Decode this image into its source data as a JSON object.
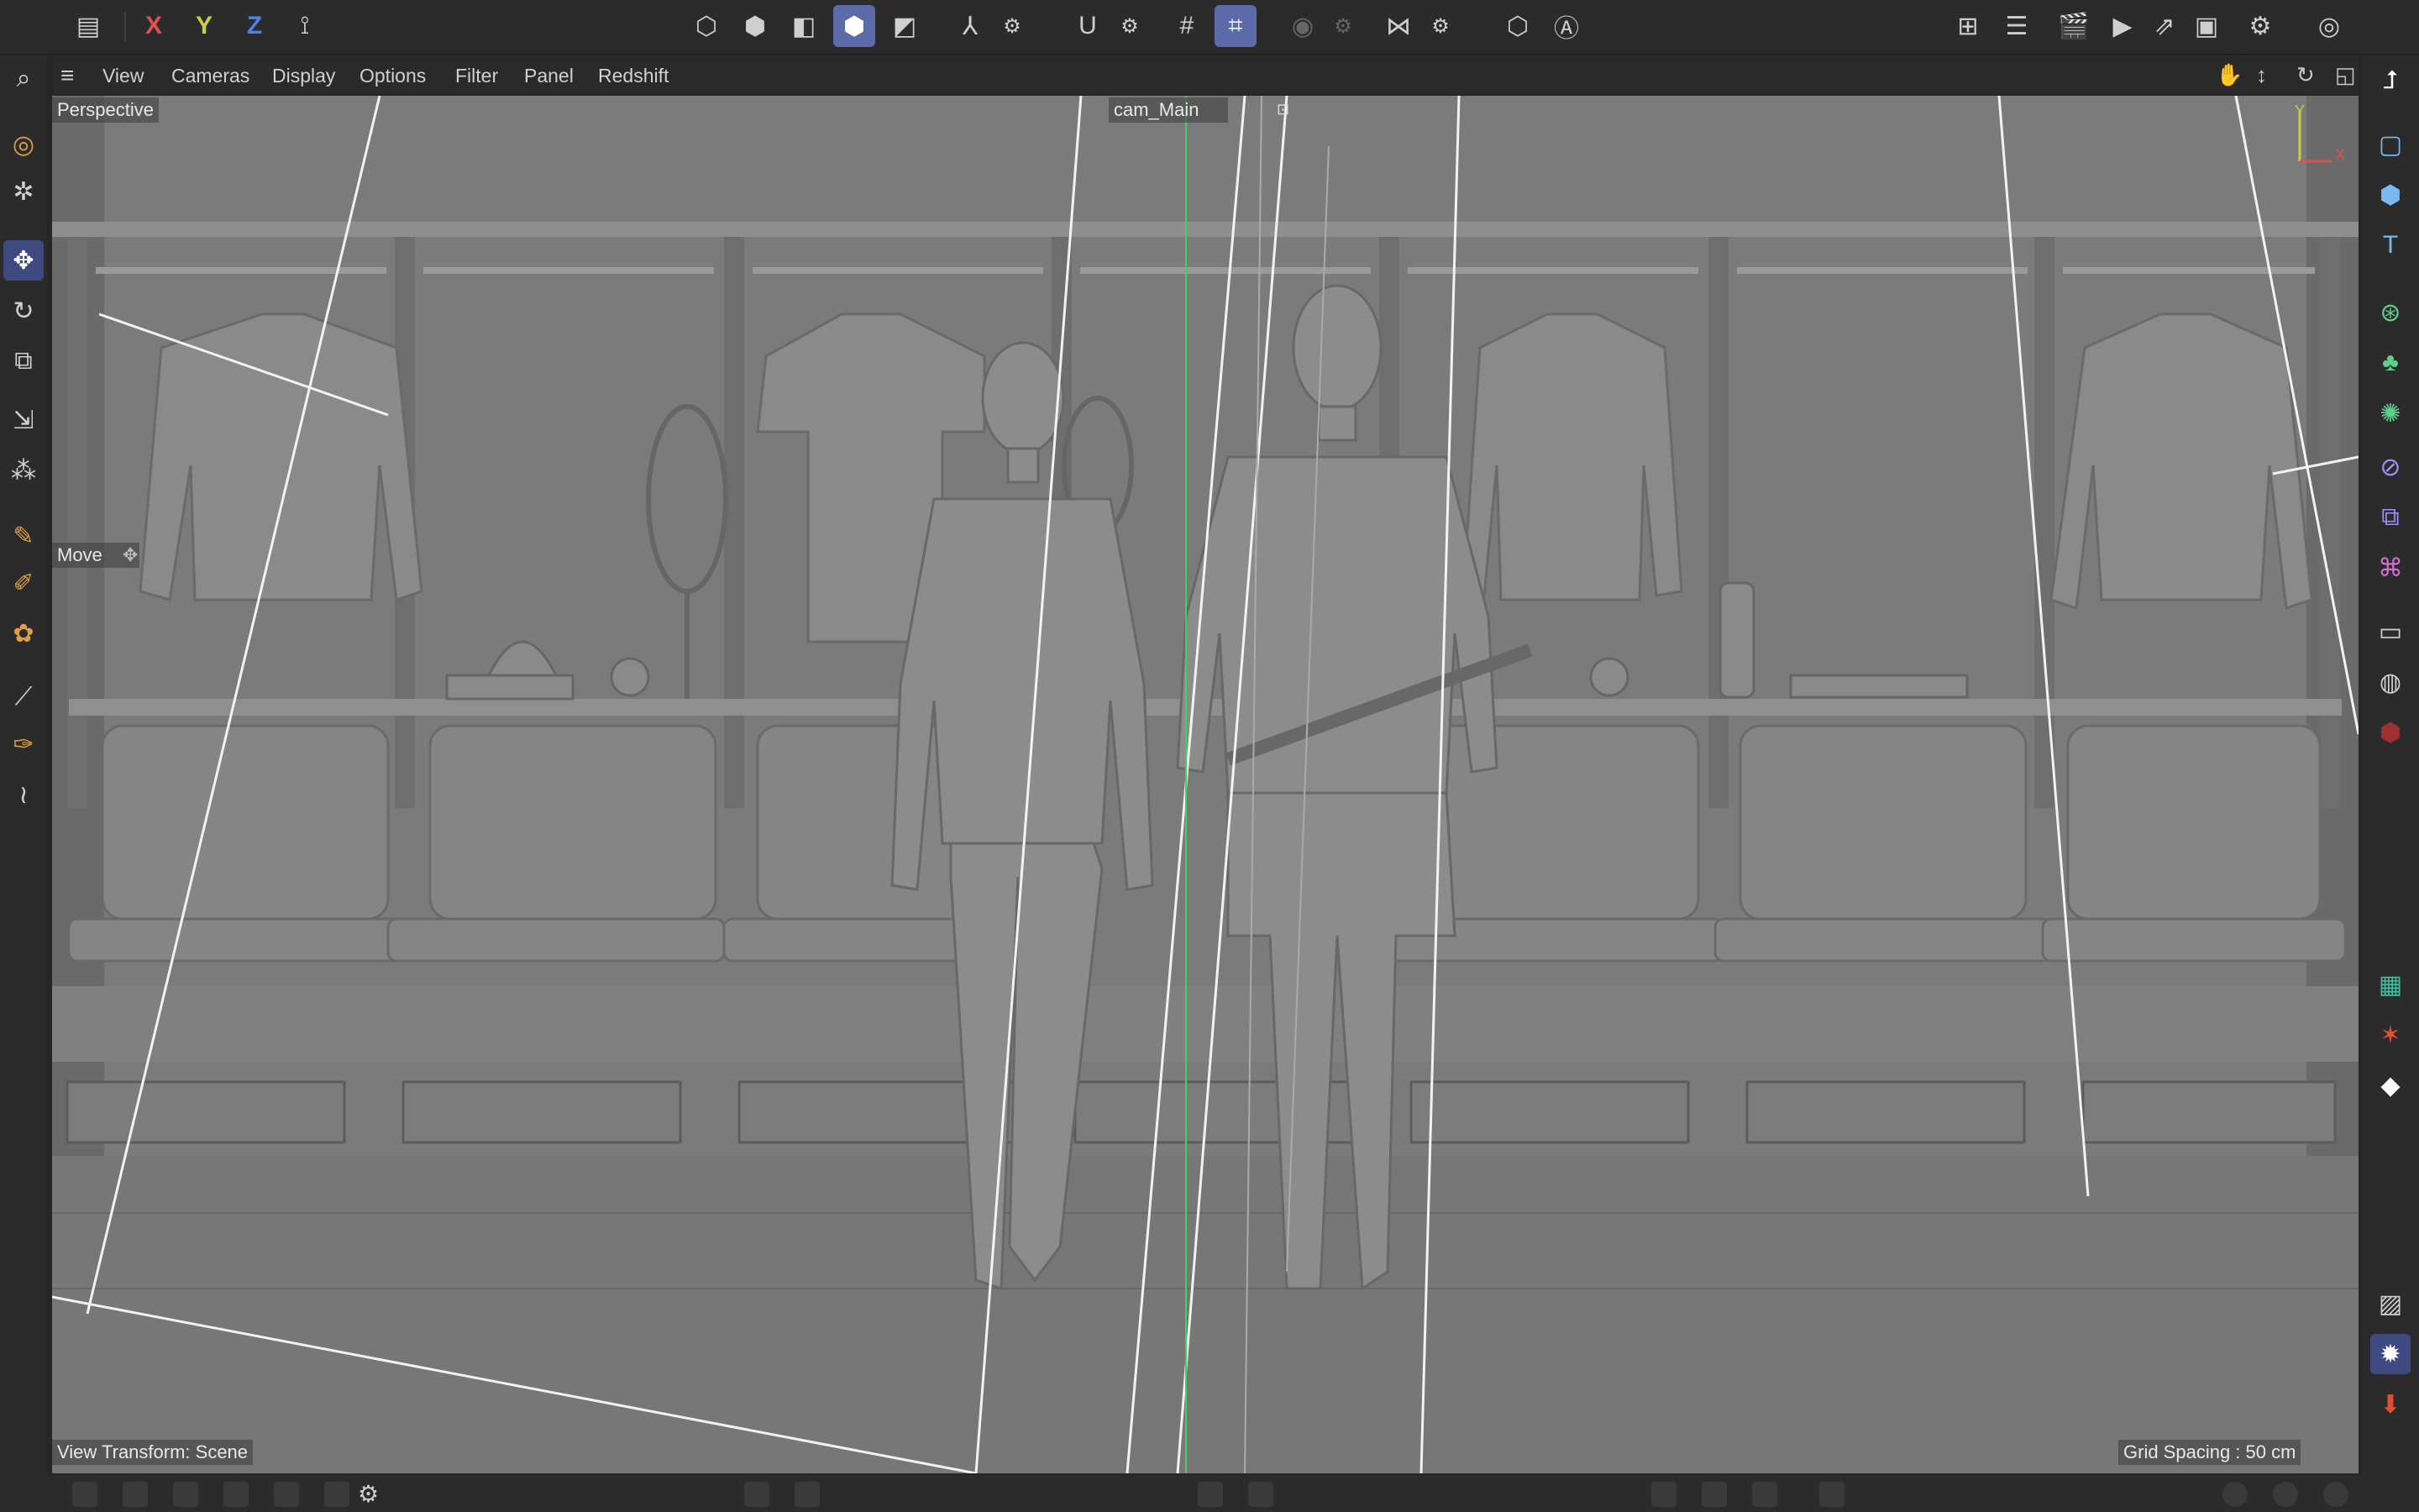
{
  "toolbar": {
    "axis_x": "X",
    "axis_y": "Y",
    "axis_z": "Z"
  },
  "menu": {
    "items": [
      "View",
      "Cameras",
      "Display",
      "Options",
      "Filter",
      "Panel",
      "Redshift"
    ]
  },
  "viewport": {
    "view_name": "Perspective",
    "camera_name": "cam_Main",
    "active_tool": "Move",
    "view_transform": "View Transform: Scene",
    "grid_spacing": "Grid Spacing : 50 cm",
    "gizmo_y": "Y",
    "gizmo_x": "X"
  },
  "colors": {
    "accent": "#5b6aa8",
    "axis_x": "#e05050",
    "axis_y": "#c8d040",
    "axis_z": "#5080e0",
    "viewport_bg": "#7a7a7a"
  },
  "icons": {
    "left_bar": [
      "search-icon",
      "live-select-icon",
      "scale-tool-icon",
      "move-icon",
      "rotate-icon",
      "scale-icon",
      "transform-icon",
      "place-icon",
      "spline-pen-icon",
      "sketch-icon",
      "brush-icon",
      "paint-icon",
      "knife-icon",
      "weld-icon"
    ],
    "right_bar": [
      "view-layout-icon",
      "cube-icon",
      "text-icon",
      "generator-icon",
      "cloner-icon",
      "deformer-icon",
      "field-icon",
      "selection-icon",
      "spline-icon",
      "camera-icon",
      "sky-icon",
      "material-icon",
      "render-settings-icon",
      "fracture-icon",
      "floor-icon",
      "picture-viewer-icon",
      "settings-gear-icon",
      "download-icon"
    ]
  }
}
